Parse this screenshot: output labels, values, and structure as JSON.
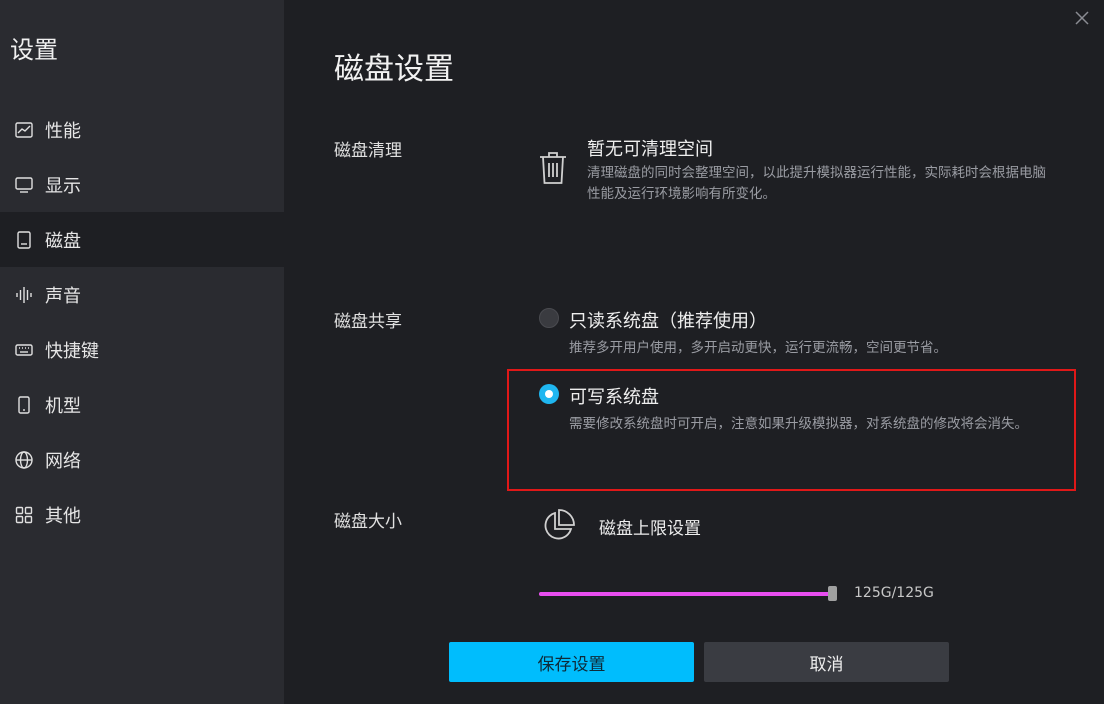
{
  "sidebar": {
    "title": "设置",
    "items": [
      {
        "label": "性能",
        "icon": "chart-icon"
      },
      {
        "label": "显示",
        "icon": "monitor-icon"
      },
      {
        "label": "磁盘",
        "icon": "disk-icon"
      },
      {
        "label": "声音",
        "icon": "soundwave-icon"
      },
      {
        "label": "快捷键",
        "icon": "keyboard-icon"
      },
      {
        "label": "机型",
        "icon": "phone-icon"
      },
      {
        "label": "网络",
        "icon": "globe-icon"
      },
      {
        "label": "其他",
        "icon": "grid-icon"
      }
    ],
    "active_item": "磁盘"
  },
  "main": {
    "title": "磁盘设置",
    "cleanup": {
      "label": "磁盘清理",
      "title": "暂无可清理空间",
      "description": "清理磁盘的同时会整理空间，以此提升模拟器运行性能，实际耗时会根据电脑性能及运行环境影响有所变化。"
    },
    "sharing": {
      "label": "磁盘共享",
      "options": [
        {
          "title": "只读系统盘（推荐使用）",
          "description": "推荐多开用户使用，多开启动更快，运行更流畅，空间更节省。",
          "selected": false
        },
        {
          "title": "可写系统盘",
          "description": "需要修改系统盘时可开启，注意如果升级模拟器，对系统盘的修改将会消失。",
          "selected": true
        }
      ]
    },
    "size": {
      "label": "磁盘大小",
      "limit_title": "磁盘上限设置",
      "value_text": "125G/125G",
      "value_gb": 125,
      "max_gb": 125
    }
  },
  "buttons": {
    "save": "保存设置",
    "cancel": "取消"
  },
  "colors": {
    "accent": "#00bdfd",
    "slider": "#e84ef0",
    "highlight": "#e01818"
  }
}
